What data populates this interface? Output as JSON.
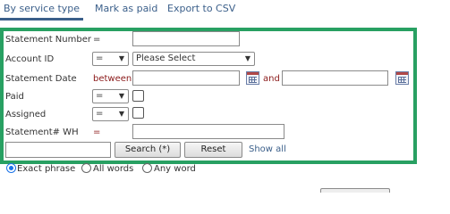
{
  "toolbar": {
    "by_service_type": "By service type",
    "mark_as_paid": "Mark as paid",
    "export_csv": "Export to CSV"
  },
  "filters": {
    "statement_number": {
      "label": "Statement Number",
      "operator": "=",
      "value": ""
    },
    "account_id": {
      "label": "Account ID",
      "operator": "=",
      "value": "Please Select"
    },
    "statement_date": {
      "label": "Statement Date",
      "operator": "between",
      "from": "",
      "joiner": "and",
      "to": ""
    },
    "paid": {
      "label": "Paid",
      "operator": "=",
      "checked": false
    },
    "assigned": {
      "label": "Assigned",
      "operator": "=",
      "checked": false
    },
    "statement_wh": {
      "label": "Statement# WH",
      "operator": "=",
      "value": ""
    }
  },
  "search": {
    "query": "",
    "search_button": "Search (*)",
    "reset_button": "Reset",
    "show_all": "Show all"
  },
  "match_mode": {
    "options": [
      "Exact phrase",
      "All words",
      "Any word"
    ],
    "selected": "Exact phrase"
  },
  "colors": {
    "panel_border": "#28a062",
    "link": "#3b5f8a",
    "operator_red": "#8b1a1a"
  }
}
